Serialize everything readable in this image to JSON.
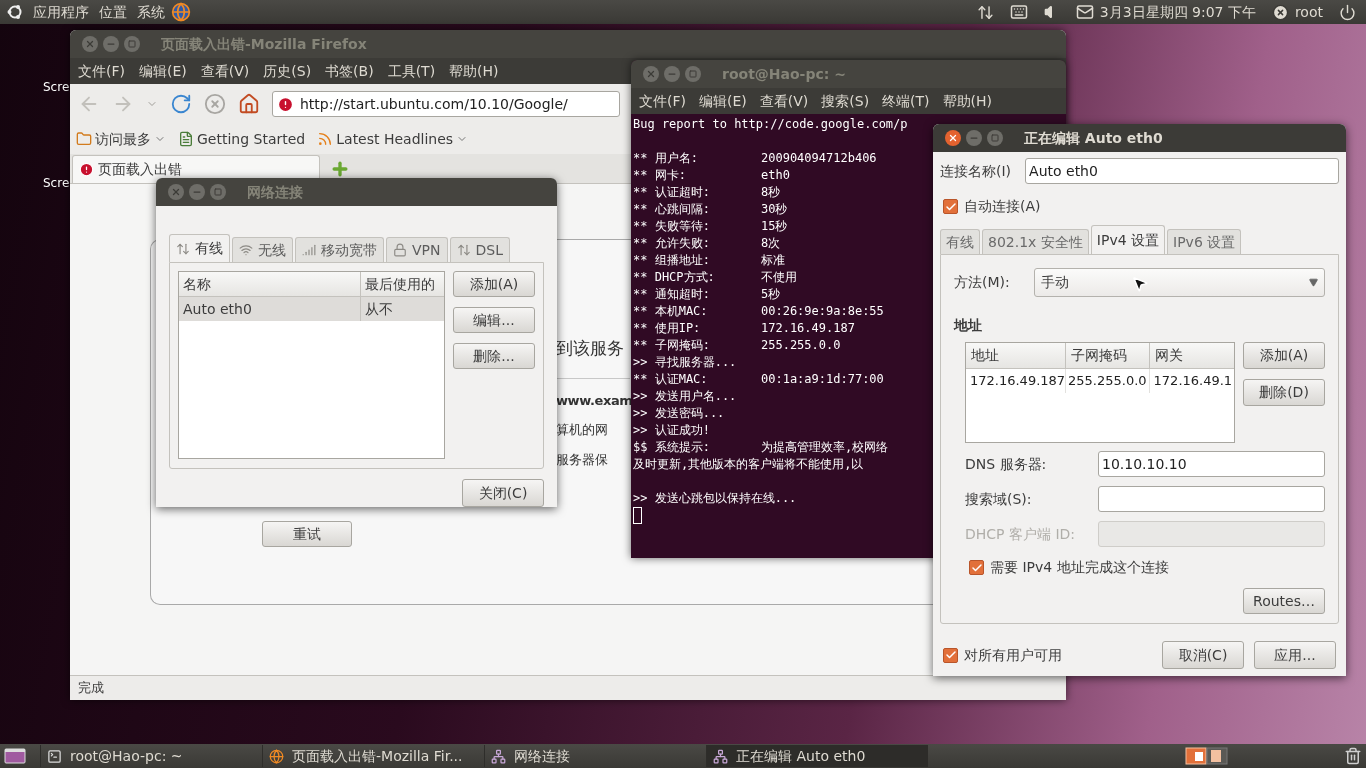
{
  "top_panel": {
    "menus": [
      "应用程序",
      "位置",
      "系统"
    ],
    "clock": "3月3日星期四 9:07 下午",
    "user": "root"
  },
  "desktop_icons": [
    {
      "label": "Scre"
    },
    {
      "label": "Scre"
    }
  ],
  "firefox": {
    "title": "页面载入出错-Mozilla Firefox",
    "focused": false,
    "menu": [
      "文件(F)",
      "编辑(E)",
      "查看(V)",
      "历史(S)",
      "书签(B)",
      "工具(T)",
      "帮助(H)"
    ],
    "url": "http://start.ubuntu.com/10.10/Google/",
    "bookmarks": [
      {
        "kind": "folder",
        "label": "访问最多",
        "dropdown": true
      },
      {
        "kind": "page",
        "label": "Getting Started",
        "dropdown": false
      },
      {
        "kind": "feed",
        "label": "Latest Headlines",
        "dropdown": true
      }
    ],
    "tab": {
      "title": "页面载入出错"
    },
    "page": {
      "heading": "到该服务",
      "lines": [
        {
          "text": "www.exam",
          "bold": true
        },
        {
          "text": "算机的网",
          "bold": false
        },
        {
          "text": "服务器保",
          "bold": false
        }
      ],
      "retry_button": "重试"
    },
    "status": "完成"
  },
  "terminal": {
    "title": "root@Hao-pc: ~",
    "focused": false,
    "menu": [
      "文件(F)",
      "编辑(E)",
      "查看(V)",
      "搜索(S)",
      "终端(T)",
      "帮助(H)"
    ],
    "lines": [
      {
        "kind": "line",
        "text": "Bug report to http://code.google.com/p"
      },
      {
        "kind": "blank"
      },
      {
        "kind": "field",
        "text": "** 用户名:",
        "value": "200904094712b406"
      },
      {
        "kind": "field",
        "text": "** 网卡:",
        "value": "eth0"
      },
      {
        "kind": "field",
        "text": "** 认证超时:",
        "value": "8秒"
      },
      {
        "kind": "field",
        "text": "** 心跳间隔:",
        "value": "30秒"
      },
      {
        "kind": "field",
        "text": "** 失败等待:",
        "value": "15秒"
      },
      {
        "kind": "field",
        "text": "** 允许失败:",
        "value": "8次"
      },
      {
        "kind": "field",
        "text": "** 组播地址:",
        "value": "标准"
      },
      {
        "kind": "field",
        "text": "** DHCP方式:",
        "value": "不使用"
      },
      {
        "kind": "field",
        "text": "** 通知超时:",
        "value": "5秒"
      },
      {
        "kind": "field",
        "text": "** 本机MAC:",
        "value": "00:26:9e:9a:8e:55"
      },
      {
        "kind": "field",
        "text": "** 使用IP:",
        "value": "172.16.49.187"
      },
      {
        "kind": "field",
        "text": "** 子网掩码:",
        "value": "255.255.0.0"
      },
      {
        "kind": "line",
        "text": ">> 寻找服务器..."
      },
      {
        "kind": "field",
        "text": "** 认证MAC:",
        "value": "00:1a:a9:1d:77:00"
      },
      {
        "kind": "line",
        "text": ">> 发送用户名..."
      },
      {
        "kind": "line",
        "text": ">> 发送密码..."
      },
      {
        "kind": "line",
        "text": ">> 认证成功!"
      },
      {
        "kind": "field",
        "text": "$$ 系统提示:",
        "value": "为提高管理效率,校网络"
      },
      {
        "kind": "line",
        "text": "及时更新,其他版本的客户端将不能使用,以"
      },
      {
        "kind": "blank"
      },
      {
        "kind": "line",
        "text": ">> 发送心跳包以保持在线..."
      }
    ]
  },
  "network_dialog": {
    "title": "网络连接",
    "focused": false,
    "tabs": [
      {
        "kind": "wired",
        "label": "有线",
        "selected": true
      },
      {
        "kind": "wireless",
        "label": "无线",
        "selected": false
      },
      {
        "kind": "mobile",
        "label": "移动宽带",
        "selected": false
      },
      {
        "kind": "vpn",
        "label": "VPN",
        "selected": false
      },
      {
        "kind": "dsl",
        "label": "DSL",
        "selected": false
      }
    ],
    "columns": [
      "名称",
      "最后使用的"
    ],
    "rows": [
      {
        "name": "Auto eth0",
        "last_used": "从不",
        "selected": true
      }
    ],
    "buttons": [
      "添加(A)",
      "编辑...",
      "删除..."
    ],
    "close_button": "关闭(C)"
  },
  "edit_dialog": {
    "title": "正在编辑 Auto eth0",
    "focused": true,
    "name_label": "连接名称(I)",
    "name_value": "Auto eth0",
    "auto_connect": {
      "label": "自动连接(A)",
      "checked": true
    },
    "tabs": [
      {
        "label": "有线",
        "selected": false
      },
      {
        "label": "802.1x 安全性",
        "selected": false
      },
      {
        "label": "IPv4 设置",
        "selected": true
      },
      {
        "label": "IPv6 设置",
        "selected": false
      }
    ],
    "method_label": "方法(M):",
    "method_value": "手动",
    "address_heading": "地址",
    "columns": [
      "地址",
      "子网掩码",
      "网关"
    ],
    "rows": [
      {
        "address": "172.16.49.187",
        "netmask": "255.255.0.0",
        "gateway": "172.16.49.1"
      }
    ],
    "address_buttons": [
      "添加(A)",
      "删除(D)"
    ],
    "fields": [
      {
        "label": "DNS 服务器:",
        "value": "10.10.10.10",
        "disabled": false
      },
      {
        "label": "搜索域(S):",
        "disabled": false
      },
      {
        "label": "DHCP 客户端 ID:",
        "disabled": true
      }
    ],
    "require_ipv4": {
      "label": "需要 IPv4 地址完成这个连接",
      "checked": true
    },
    "routes_button": "Routes…",
    "all_users": {
      "label": "对所有用户可用",
      "checked": true
    },
    "buttons": [
      "取消(C)",
      "应用..."
    ]
  },
  "taskbar": {
    "items": [
      {
        "kind": "terminal",
        "label": "root@Hao-pc: ~",
        "selected": false
      },
      {
        "kind": "browser",
        "label": "页面载入出错-Mozilla Fir...",
        "selected": false
      },
      {
        "kind": "network",
        "label": "网络连接",
        "selected": false
      },
      {
        "kind": "network",
        "label": "正在编辑 Auto eth0",
        "selected": true
      }
    ]
  }
}
